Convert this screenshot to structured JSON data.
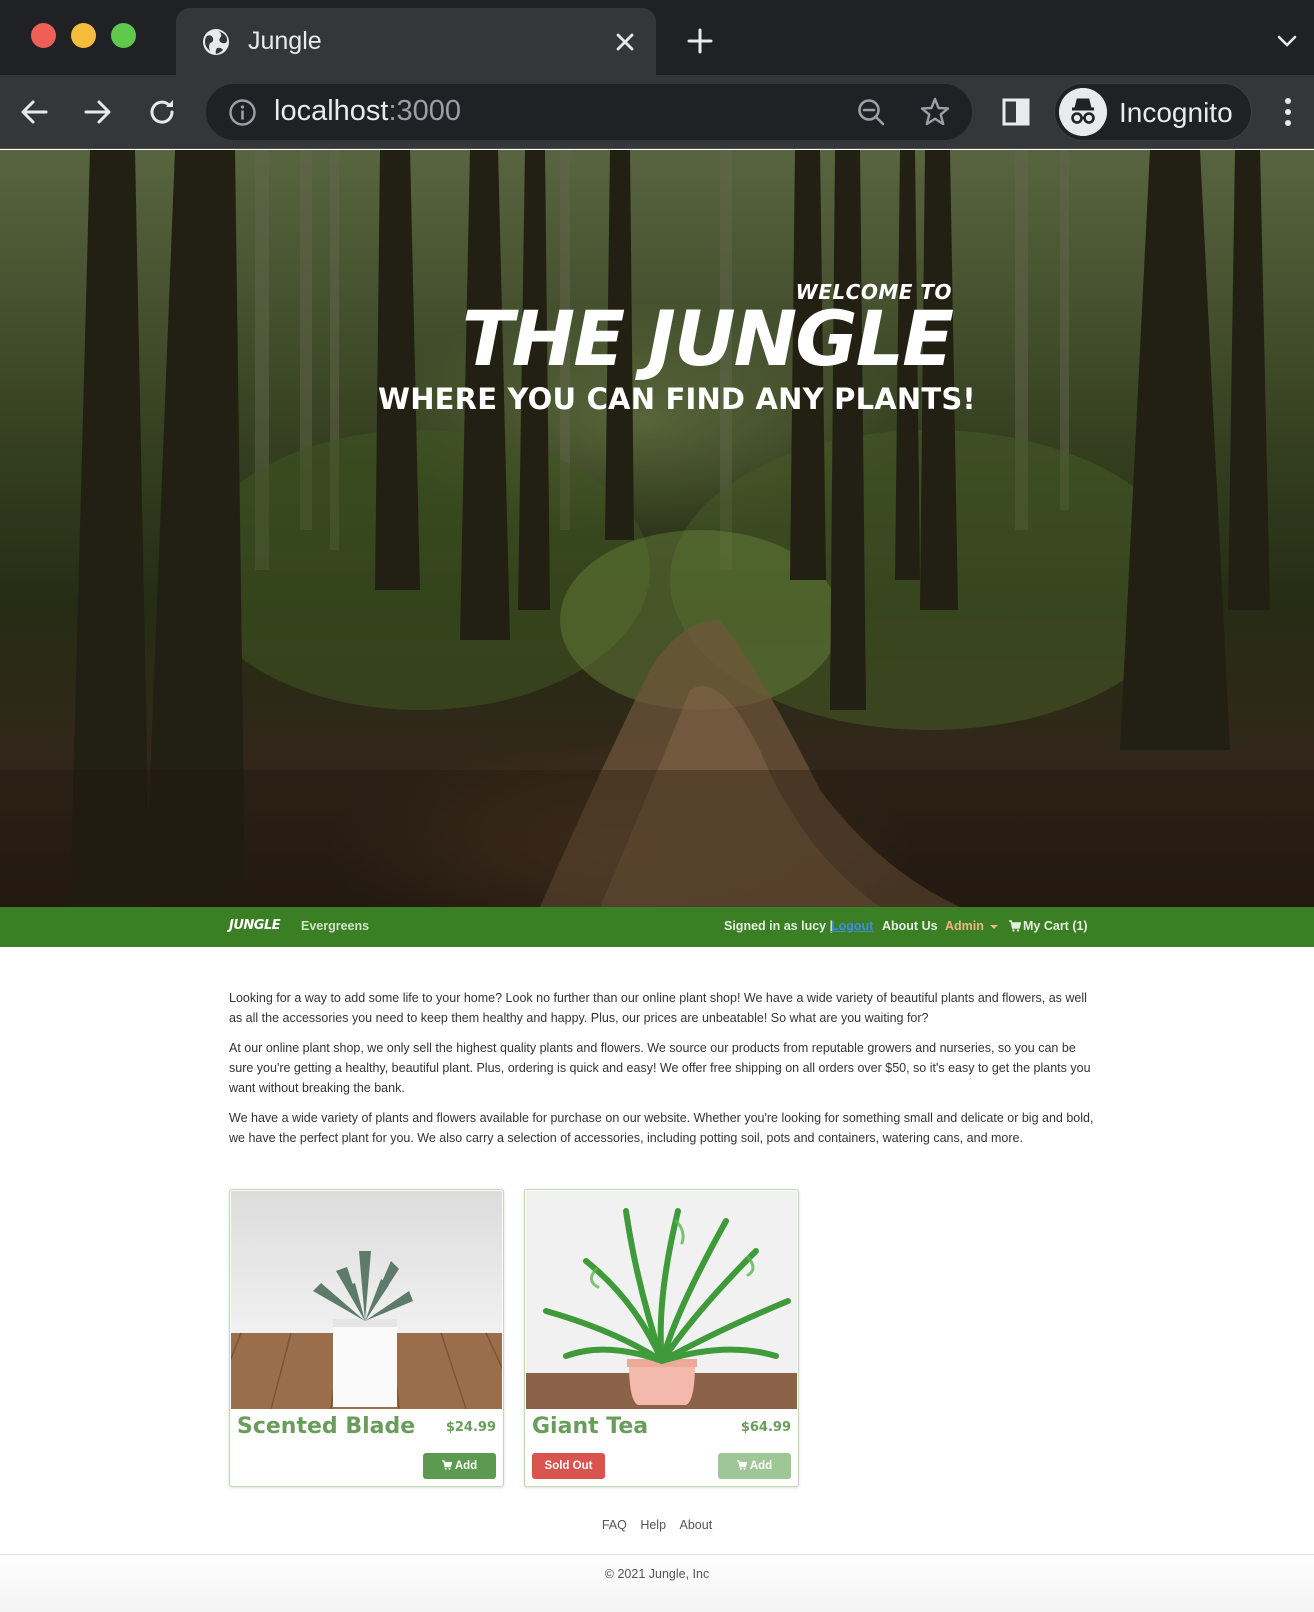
{
  "browser": {
    "tab_title": "Jungle",
    "url_host": "localhost",
    "url_port": ":3000",
    "profile_label": "Incognito"
  },
  "hero": {
    "welcome": "WELCOME TO",
    "title": "THE JUNGLE",
    "subtitle": "WHERE YOU CAN FIND ANY PLANTS!"
  },
  "nav": {
    "brand": "JUNGLE",
    "category": "Evergreens",
    "signed_in": "Signed in as lucy |",
    "logout": "Logout",
    "about": "About Us",
    "admin": "Admin",
    "cart": "My Cart (1)",
    "accent_color": "#3b7f24"
  },
  "intro": {
    "paragraphs": [
      "Looking for a way to add some life to your home? Look no further than our online plant shop! We have a wide variety of beautiful plants and flowers, as well as all the accessories you need to keep them healthy and happy. Plus, our prices are unbeatable! So what are you waiting for?",
      "At our online plant shop, we only sell the highest quality plants and flowers. We source our products from reputable growers and nurseries, so you can be sure you're getting a healthy, beautiful plant. Plus, ordering is quick and easy! We offer free shipping on all orders over $50, so it's easy to get the plants you want without breaking the bank.",
      "We have a wide variety of plants and flowers available for purchase on our website. Whether you're looking for something small and delicate or big and bold, we have the perfect plant for you. We also carry a selection of accessories, including potting soil, pots and containers, watering cans, and more."
    ]
  },
  "products": [
    {
      "name": "Scented Blade",
      "price": "$24.99",
      "add_label": "Add",
      "sold_out": false
    },
    {
      "name": "Giant Tea",
      "price": "$64.99",
      "add_label": "Add",
      "sold_out": true,
      "sold_out_label": "Sold Out"
    }
  ],
  "footer": {
    "links": [
      "FAQ",
      "Help",
      "About"
    ],
    "copyright": "© 2021 Jungle, Inc"
  }
}
